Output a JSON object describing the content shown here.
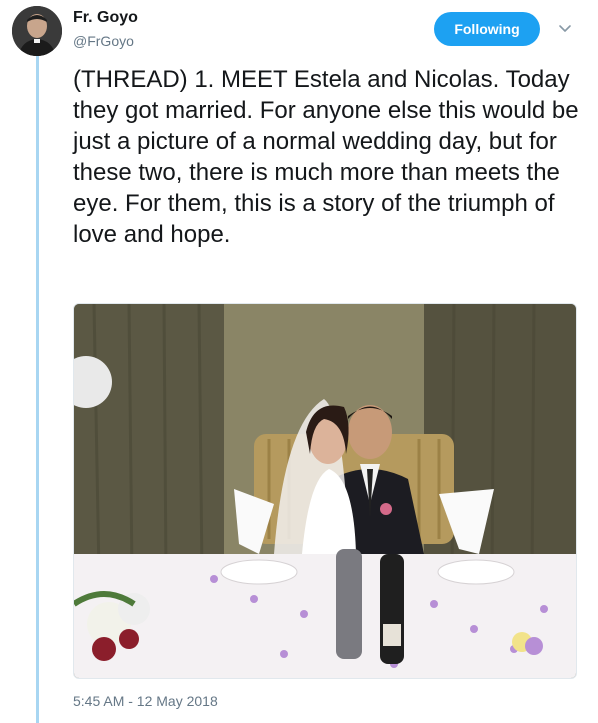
{
  "author": {
    "name": "Fr. Goyo",
    "handle": "@FrGoyo"
  },
  "follow_button": {
    "label": "Following"
  },
  "caret_icon": "chevron-down-icon",
  "tweet": {
    "text": "(THREAD) 1. MEET Estela and Nicolas. Today they got married. For anyone else this would be just a picture of a normal wedding day, but for these two, there is much more than meets the eye. For them, this is a story of the triumph of love and hope.",
    "timestamp": "5:45 AM - 12 May 2018"
  },
  "colors": {
    "accent": "#1da1f2",
    "thread_line": "#a8d6f2",
    "secondary_text": "#657786"
  }
}
